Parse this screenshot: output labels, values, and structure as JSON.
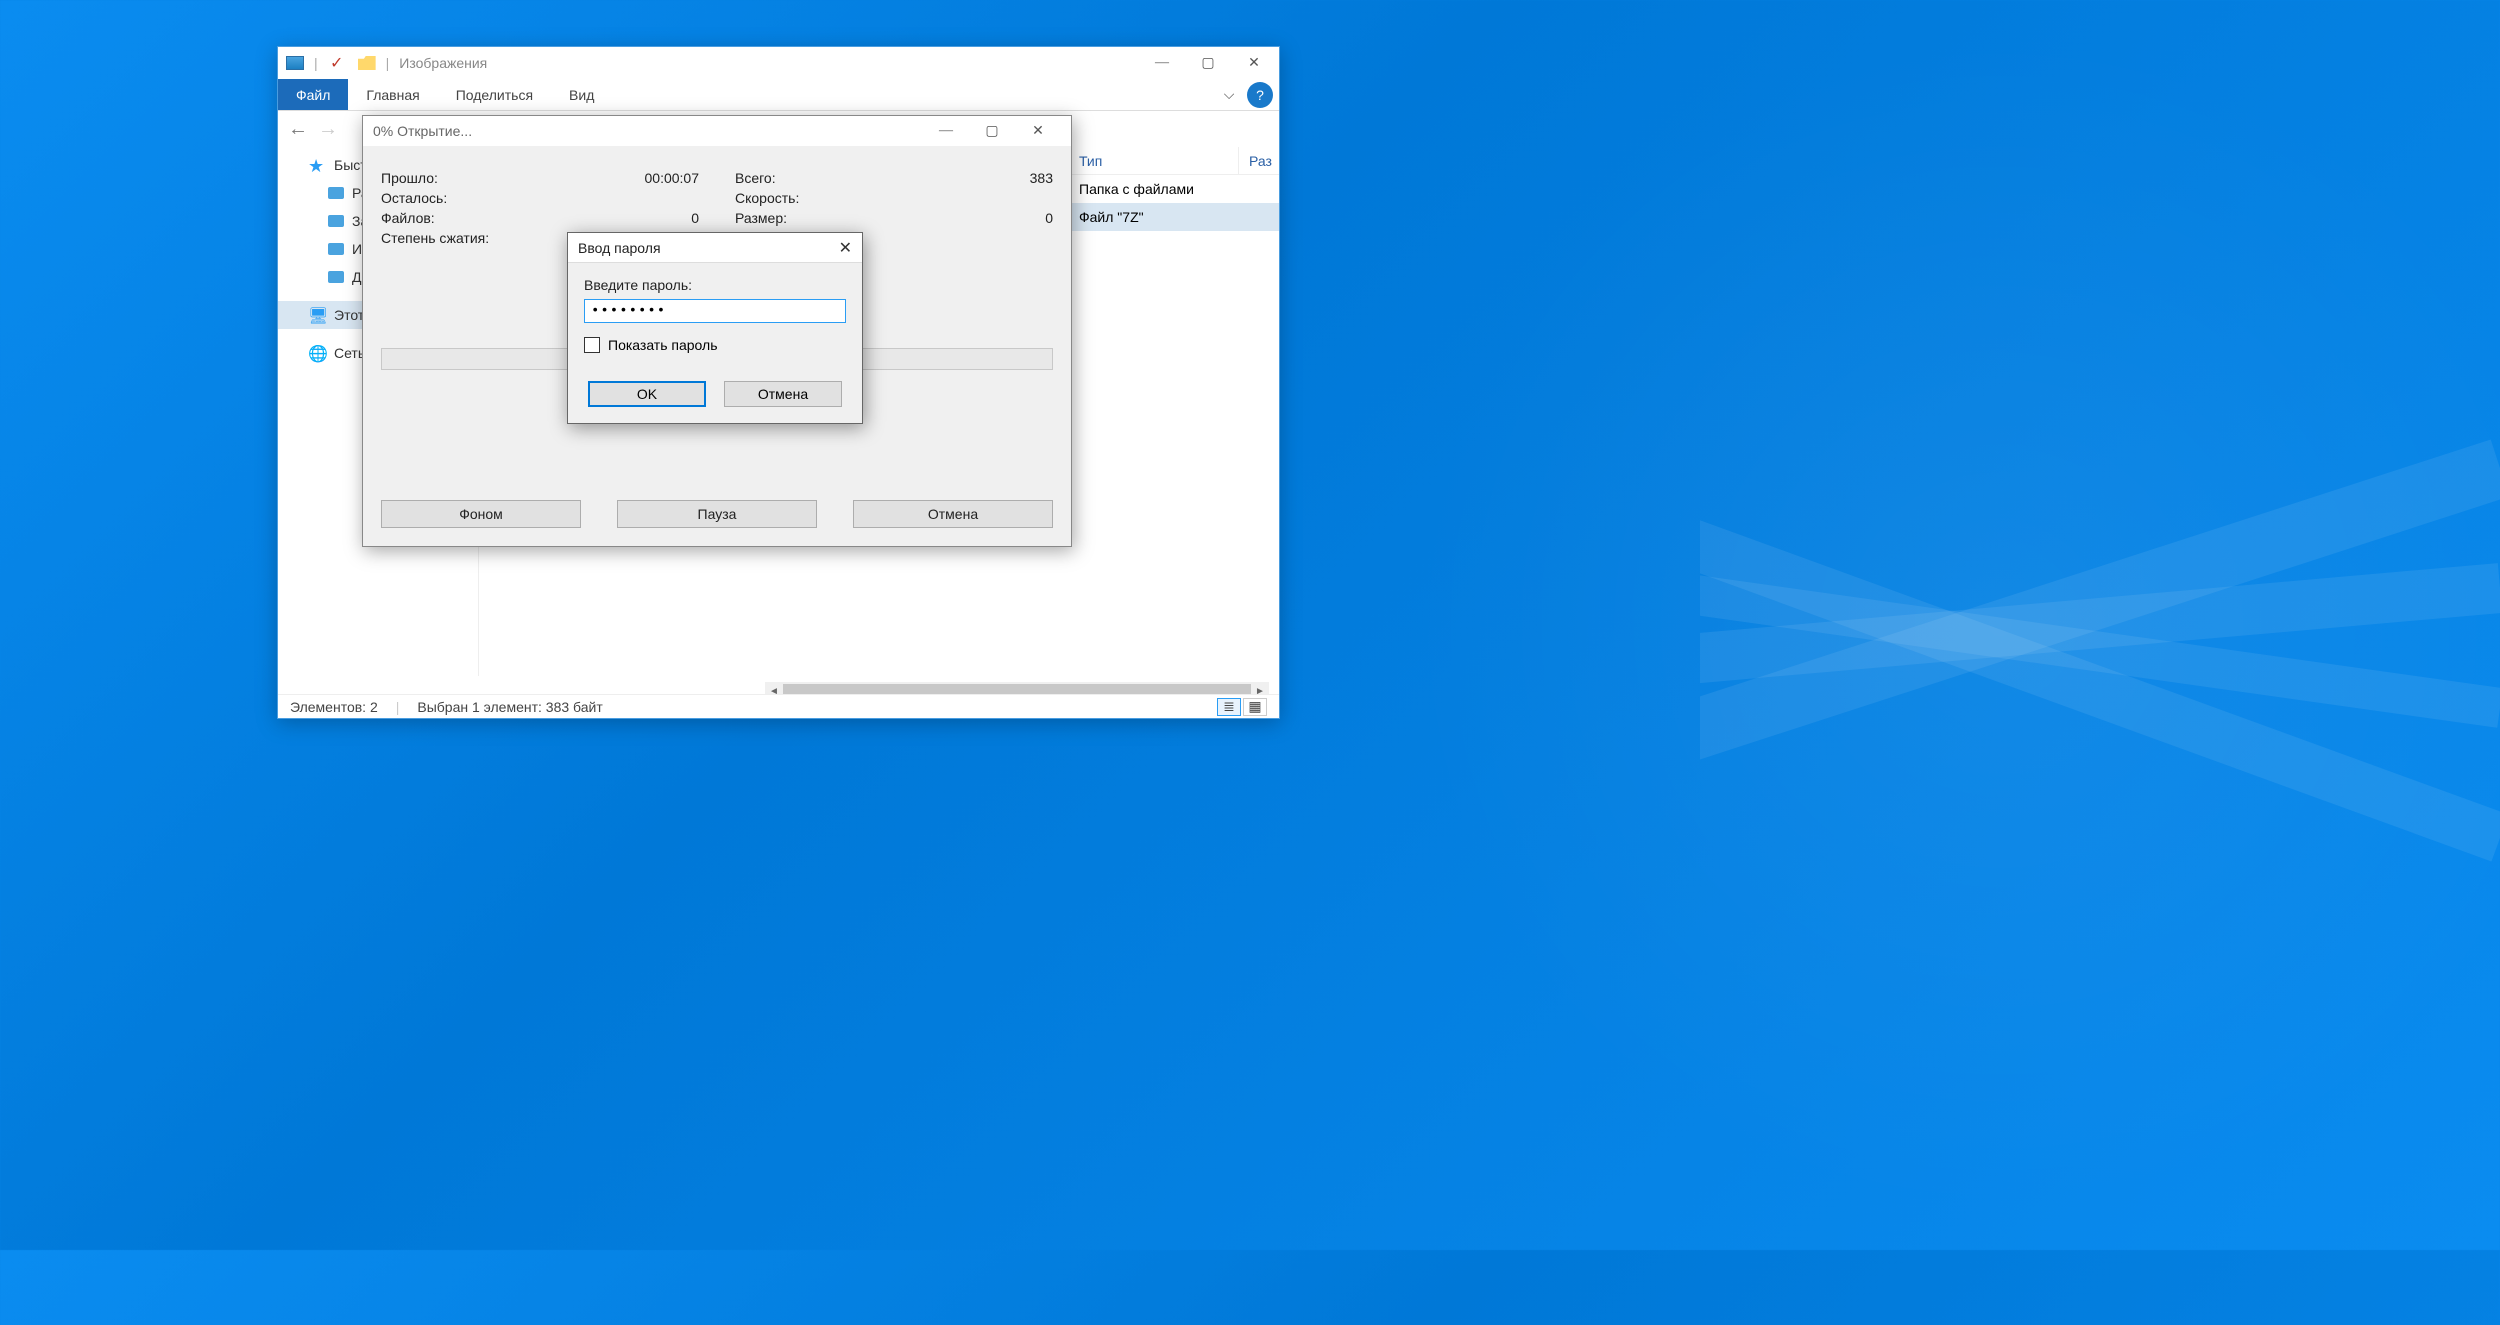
{
  "explorer": {
    "title": "Изображения",
    "ribbon": {
      "file": "Файл",
      "tabs": [
        "Главная",
        "Поделиться",
        "Вид"
      ]
    },
    "sidebar": {
      "quick": "Быстр",
      "quick_items": [
        "Раб",
        "Заг",
        "Изо",
        "Док"
      ],
      "this_pc": "Этот",
      "network": "Сеть"
    },
    "columns": {
      "type": "Тип",
      "size": "Раз"
    },
    "rows": [
      {
        "type": "Папка с файлами"
      },
      {
        "type": "Файл \"7Z\""
      }
    ],
    "status": {
      "items": "Элементов: 2",
      "selected": "Выбран 1 элемент: 383 байт"
    }
  },
  "progress": {
    "title": "0% Открытие...",
    "left": {
      "elapsed_label": "Прошло:",
      "elapsed_value": "00:00:07",
      "remaining_label": "Осталось:",
      "remaining_value": "",
      "files_label": "Файлов:",
      "files_value": "0",
      "ratio_label": "Степень сжатия:",
      "ratio_value": ""
    },
    "right": {
      "total_label": "Всего:",
      "total_value": "383",
      "speed_label": "Скорость:",
      "speed_value": "",
      "size_label": "Размер:",
      "size_value": "0"
    },
    "buttons": {
      "background": "Фоном",
      "pause": "Пауза",
      "cancel": "Отмена"
    }
  },
  "password_dialog": {
    "title": "Ввод пароля",
    "prompt": "Введите пароль:",
    "value": "********",
    "show_password": "Показать пароль",
    "ok": "OK",
    "cancel": "Отмена"
  }
}
